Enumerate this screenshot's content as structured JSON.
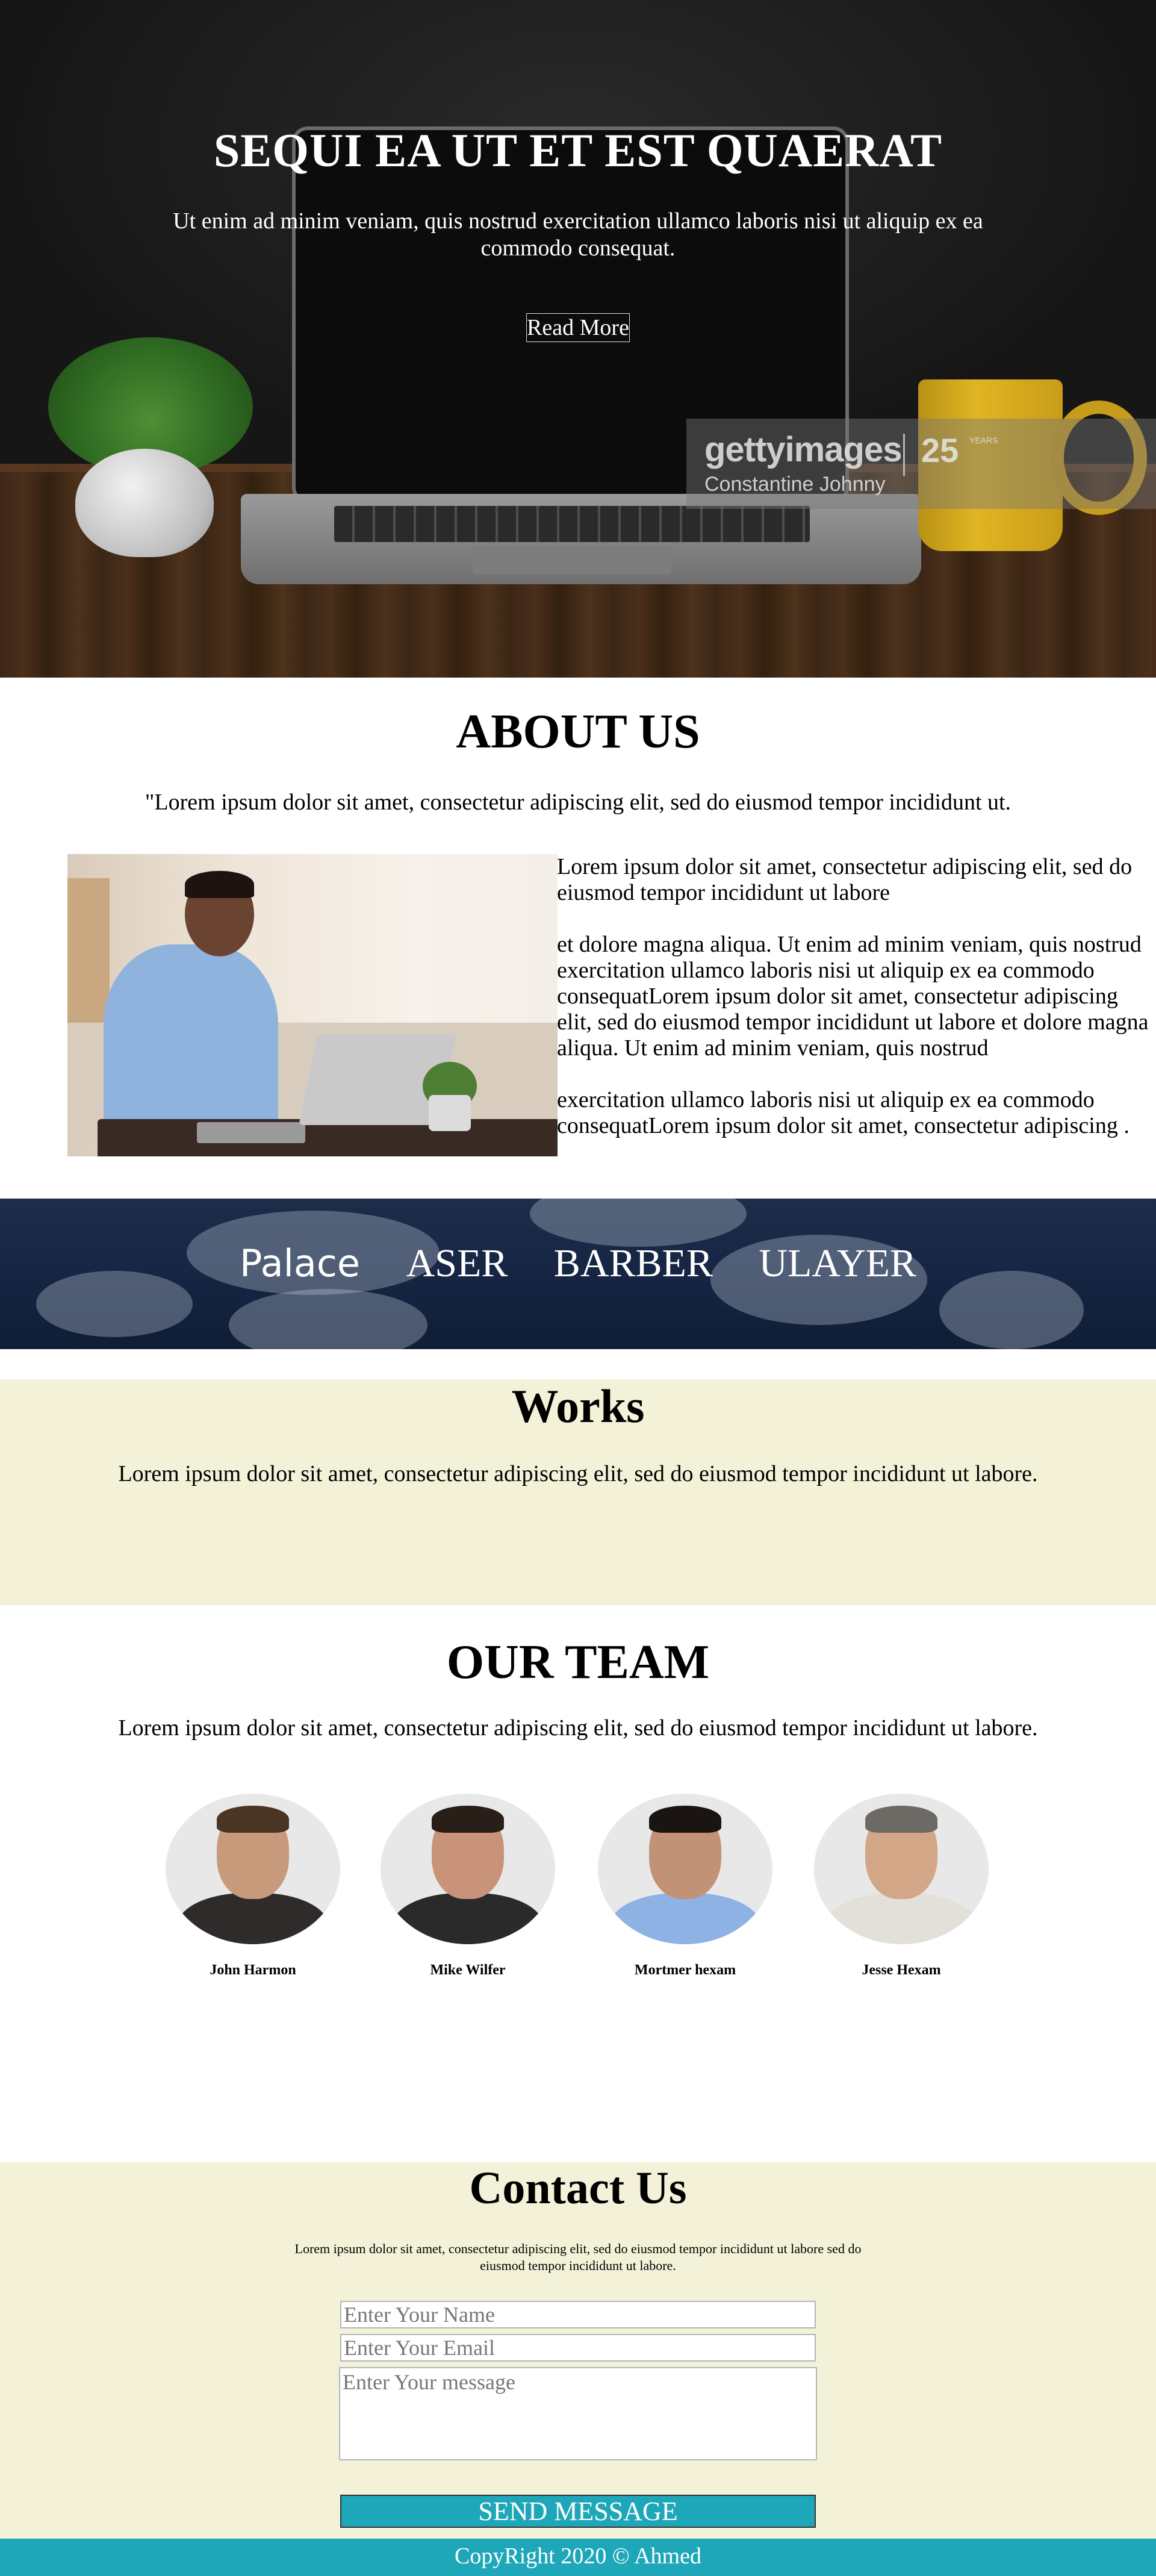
{
  "hero": {
    "title": "SEQUI EA UT ET EST QUAERAT",
    "subtitle": "Ut enim ad minim veniam, quis nostrud exercitation ullamco laboris nisi ut aliquip ex ea commodo consequat.",
    "button_label": "Read More",
    "watermark": {
      "logo": "gettyimages",
      "years": "25",
      "years_label": "YEARS",
      "credit": "Constantine Johnny"
    }
  },
  "about": {
    "title": "ABOUT US",
    "quote": "\"Lorem ipsum dolor sit amet, consectetur adipiscing elit, sed do eiusmod tempor incididunt ut.",
    "paragraphs": [
      "Lorem ipsum dolor sit amet, consectetur adipiscing elit, sed do eiusmod tempor incididunt ut labore",
      "et dolore magna aliqua. Ut enim ad minim veniam, quis nostrud exercitation ullamco laboris nisi ut aliquip ex ea commodo consequatLorem ipsum dolor sit amet, consectetur adipiscing elit, sed do eiusmod tempor incididunt ut labore et dolore magna aliqua. Ut enim ad minim veniam, quis nostrud",
      "exercitation ullamco laboris nisi ut aliquip ex ea commodo consequatLorem ipsum dolor sit amet, consectetur adipiscing ."
    ]
  },
  "clients": [
    "Palace",
    "ASER",
    "BARBER",
    "ULAYER"
  ],
  "works": {
    "title": "Works",
    "description": "Lorem ipsum dolor sit amet, consectetur adipiscing elit, sed do eiusmod tempor incididunt ut labore."
  },
  "team": {
    "title": "OUR TEAM",
    "description": "Lorem ipsum dolor sit amet, consectetur adipiscing elit, sed do eiusmod tempor incididunt ut labore.",
    "members": [
      {
        "name": "John Harmon"
      },
      {
        "name": "Mike Wilfer"
      },
      {
        "name": "Mortmer hexam"
      },
      {
        "name": "Jesse Hexam"
      }
    ]
  },
  "contact": {
    "title": "Contact Us",
    "description": "Lorem ipsum dolor sit amet, consectetur adipiscing elit, sed do eiusmod tempor incididunt ut labore sed do eiusmod tempor incididunt ut labore.",
    "name_placeholder": "Enter Your Name",
    "email_placeholder": "Enter Your Email",
    "message_placeholder": "Enter Your message",
    "send_label": "SEND MESSAGE"
  },
  "footer": {
    "text": "CopyRight 2020 © Ahmed"
  },
  "colors": {
    "accent": "#1ea7b9",
    "section_bg": "#f3f2d9"
  }
}
